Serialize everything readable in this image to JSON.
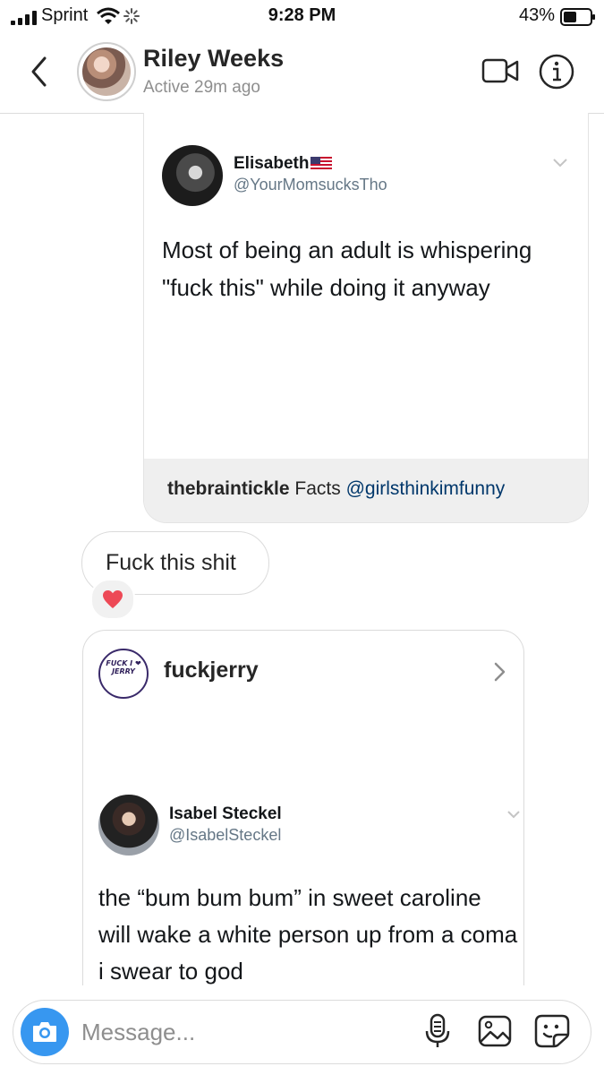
{
  "status_bar": {
    "carrier": "Sprint",
    "time": "9:28 PM",
    "battery": "43%"
  },
  "header": {
    "name": "Riley Weeks",
    "active_status": "Active 29m ago"
  },
  "shared_tweet": {
    "author_name": "Elisabeth",
    "author_handle": "@YourMomsucksTho",
    "text": "Most of being an adult is whispering \"fuck this\" while doing it anyway",
    "caption_user": "thebraintickle",
    "caption_text": "Facts",
    "caption_mention": "@girlsthinkimfunny"
  },
  "message": {
    "text": "Fuck this shit",
    "reaction": "heart"
  },
  "shared_post": {
    "account": "fuckjerry",
    "logo_text": "FUCK I ❤ JERRY",
    "tweet": {
      "author_name": "Isabel Steckel",
      "author_handle": "@IsabelSteckel",
      "text": "the “bum bum bum” in sweet caroline will wake a white person up from a coma i swear to god"
    }
  },
  "composer": {
    "placeholder": "Message..."
  },
  "colors": {
    "accent": "#3797f0",
    "reaction_heart": "#ed4956",
    "mention": "#00376b"
  },
  "icons": [
    "back-icon",
    "video-call-icon",
    "info-icon",
    "camera-icon",
    "microphone-icon",
    "gallery-icon",
    "sticker-icon",
    "chevron-right-icon",
    "chevron-down-icon",
    "heart-icon"
  ]
}
